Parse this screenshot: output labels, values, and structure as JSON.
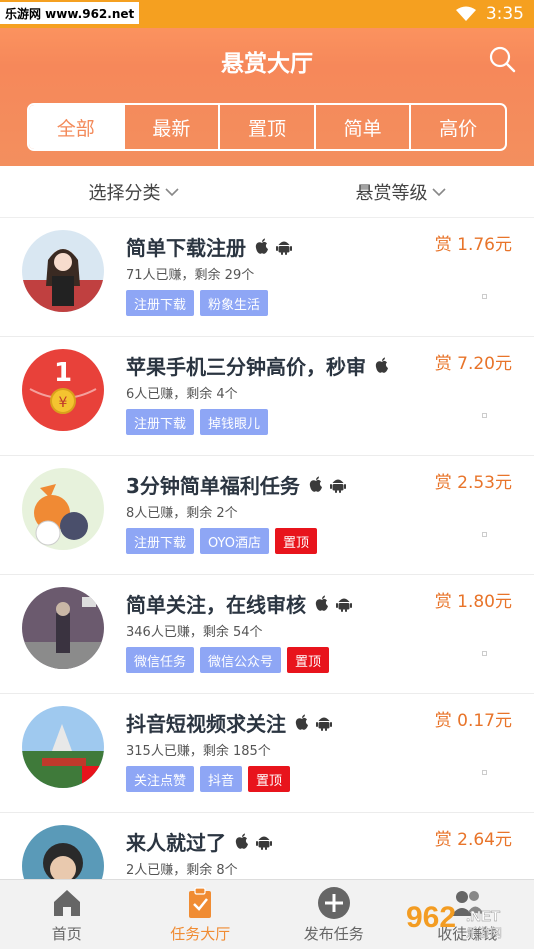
{
  "status_bar": {
    "watermark_text": "乐游网 www.962.net",
    "time": "3:35"
  },
  "header": {
    "title": "悬赏大厅"
  },
  "tabs": [
    {
      "label": "全部",
      "active": true
    },
    {
      "label": "最新",
      "active": false
    },
    {
      "label": "置顶",
      "active": false
    },
    {
      "label": "简单",
      "active": false
    },
    {
      "label": "高价",
      "active": false
    }
  ],
  "filters": [
    {
      "label": "选择分类"
    },
    {
      "label": "悬赏等级"
    }
  ],
  "tasks": [
    {
      "title": "简单下载注册",
      "meta": "71人已赚，剩余 29个",
      "tags": [
        "注册下载",
        "粉象生活"
      ],
      "pinned": false,
      "reward": "赏 1.76元",
      "platforms": [
        "apple-icon",
        "android-icon"
      ]
    },
    {
      "title": "苹果手机三分钟高价，秒审",
      "meta": "6人已赚，剩余 4个",
      "tags": [
        "注册下载",
        "掉钱眼儿"
      ],
      "pinned": false,
      "reward": "赏 7.20元",
      "platforms": [
        "apple-icon"
      ]
    },
    {
      "title": "3分钟简单福利任务",
      "meta": "8人已赚，剩余 2个",
      "tags": [
        "注册下载",
        "OYO酒店"
      ],
      "pinned": true,
      "pinned_label": "置顶",
      "reward": "赏 2.53元",
      "platforms": [
        "apple-icon",
        "android-icon"
      ]
    },
    {
      "title": "简单关注，在线审核",
      "meta": "346人已赚，剩余 54个",
      "tags": [
        "微信任务",
        "微信公众号"
      ],
      "pinned": true,
      "pinned_label": "置顶",
      "reward": "赏 1.80元",
      "platforms": [
        "apple-icon",
        "android-icon"
      ]
    },
    {
      "title": "抖音短视频求关注",
      "meta": "315人已赚，剩余 185个",
      "tags": [
        "关注点赞",
        "抖音"
      ],
      "pinned": true,
      "pinned_label": "置顶",
      "reward": "赏 0.17元",
      "platforms": [
        "apple-icon",
        "android-icon"
      ]
    },
    {
      "title": "来人就过了",
      "meta": "2人已赚，剩余 8个",
      "tags": [],
      "pinned": false,
      "reward": "赏 2.64元",
      "platforms": [
        "apple-icon",
        "android-icon"
      ]
    }
  ],
  "bottom_nav": [
    {
      "label": "首页",
      "icon": "home-icon",
      "active": false
    },
    {
      "label": "任务大厅",
      "icon": "clipboard-check-icon",
      "active": true
    },
    {
      "label": "发布任务",
      "icon": "plus-circle-icon",
      "active": false
    },
    {
      "label": "收徒赚钱",
      "icon": "users-icon",
      "active": false
    }
  ],
  "colors": {
    "accent": "#f38a5a",
    "status_bar": "#f5a020",
    "tag": "#8ea6f5",
    "pinned": "#e8141c",
    "reward": "#e8742a"
  }
}
